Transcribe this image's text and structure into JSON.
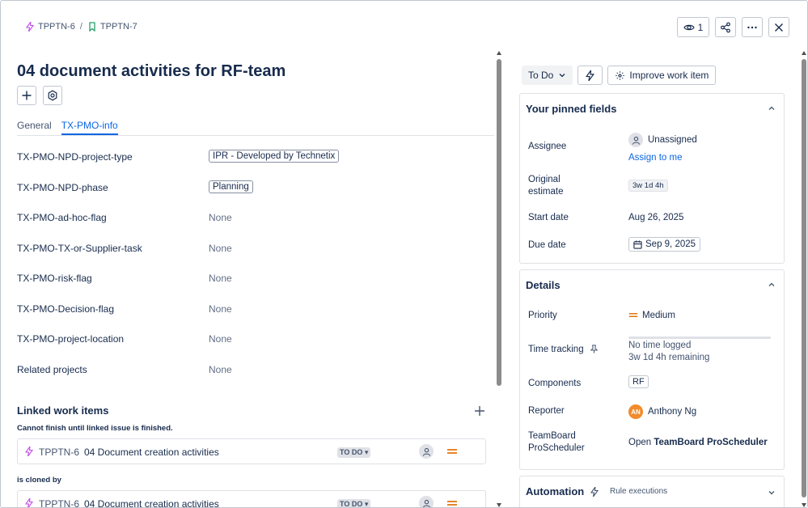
{
  "breadcrumb": {
    "parent_key": "TPPTN-6",
    "separator": "/",
    "current_key": "TPPTN-7"
  },
  "header_actions": {
    "watch_count": "1"
  },
  "issue": {
    "title": "04 document activities for RF-team"
  },
  "tabs": [
    {
      "label": "General"
    },
    {
      "label": "TX-PMO-info"
    }
  ],
  "fields": [
    {
      "label": "TX-PMO-NPD-project-type",
      "value": "IPR - Developed by Technetix"
    },
    {
      "label": "TX-PMO-NPD-phase",
      "value": "Planning"
    },
    {
      "label": "TX-PMO-ad-hoc-flag",
      "value": "None"
    },
    {
      "label": "TX-PMO-TX-or-Supplier-task",
      "value": "None"
    },
    {
      "label": "TX-PMO-risk-flag",
      "value": "None"
    },
    {
      "label": "TX-PMO-Decision-flag",
      "value": "None"
    },
    {
      "label": "TX-PMO-project-location",
      "value": "None"
    },
    {
      "label": "Related projects",
      "value": "None"
    }
  ],
  "linked": {
    "title": "Linked work items",
    "groups": [
      {
        "caption": "Cannot finish until linked issue is finished.",
        "key": "TPPTN-6",
        "summary": "04 Document creation activities",
        "status": "TO DO"
      },
      {
        "caption": "is cloned by",
        "key": "TPPTN-6",
        "summary": "04 Document creation activities",
        "status": "TO DO"
      }
    ]
  },
  "right": {
    "status": "To Do",
    "improve_label": "Improve work item",
    "pinned": {
      "title": "Your pinned fields",
      "assignee_label": "Assignee",
      "assignee_value": "Unassigned",
      "assign_to_me": "Assign to me",
      "orig_estimate_label_1": "Original",
      "orig_estimate_label_2": "estimate",
      "orig_estimate_value": "3w 1d 4h",
      "start_label": "Start date",
      "start_value": "Aug 26, 2025",
      "due_label": "Due date",
      "due_value": "Sep 9, 2025"
    },
    "details": {
      "title": "Details",
      "priority_label": "Priority",
      "priority_value": "Medium",
      "time_label": "Time tracking",
      "time_logged": "No time logged",
      "time_remaining": "3w 1d 4h remaining",
      "components_label": "Components",
      "components_value": "RF",
      "reporter_label": "Reporter",
      "reporter_initials": "AN",
      "reporter_name": "Anthony Ng",
      "teamboard_label_1": "TeamBoard",
      "teamboard_label_2": "ProScheduler",
      "teamboard_open": "Open",
      "teamboard_app": "TeamBoard ProScheduler"
    },
    "automation": {
      "title": "Automation",
      "rule_label": "Rule executions"
    }
  },
  "colors": {
    "accent": "#0c66e4",
    "priority_medium": "#e2740e",
    "avatar_reporter": "#f38b2a",
    "epic_icon": "#c9372c",
    "story_icon": "#22a06b",
    "subtask_icon": "#c24ee8"
  }
}
